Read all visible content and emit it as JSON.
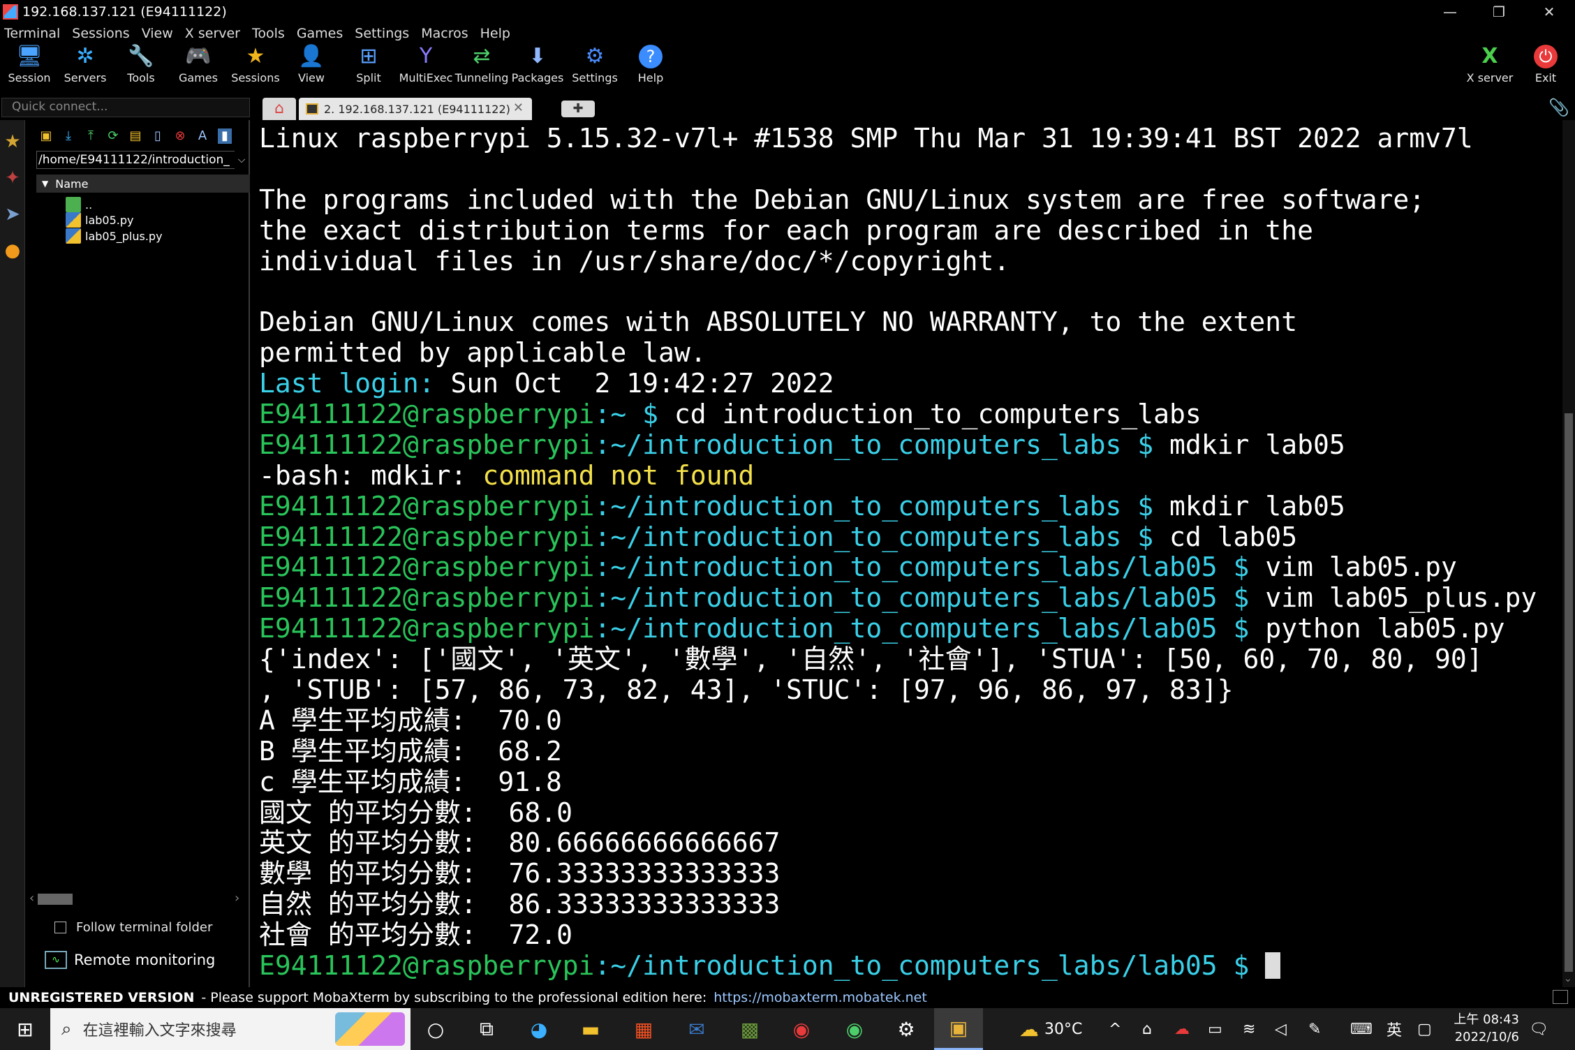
{
  "window": {
    "title": "192.168.137.121 (E94111122)",
    "controls": {
      "minimize": "—",
      "restore": "❐",
      "close": "✕"
    }
  },
  "menu": [
    "Terminal",
    "Sessions",
    "View",
    "X server",
    "Tools",
    "Games",
    "Settings",
    "Macros",
    "Help"
  ],
  "toolbar": {
    "items": [
      {
        "label": "Session",
        "icon": "session-icon",
        "glyph": "🖥",
        "color": "#4aa3ff"
      },
      {
        "label": "Servers",
        "icon": "servers-icon",
        "glyph": "✲",
        "color": "#3ab0ff"
      },
      {
        "label": "Tools",
        "icon": "tools-icon",
        "glyph": "🔧",
        "color": "#e84a4a"
      },
      {
        "label": "Games",
        "icon": "games-icon",
        "glyph": "🎮",
        "color": "#dddddd"
      },
      {
        "label": "Sessions",
        "icon": "star-icon",
        "glyph": "★",
        "color": "#f2b51c"
      },
      {
        "label": "View",
        "icon": "view-icon",
        "glyph": "👤",
        "color": "#9fc6ff"
      },
      {
        "label": "Split",
        "icon": "split-icon",
        "glyph": "⊞",
        "color": "#5aa0ff"
      },
      {
        "label": "MultiExec",
        "icon": "multiexec-icon",
        "glyph": "Y",
        "color": "#8a7cff"
      },
      {
        "label": "Tunneling",
        "icon": "tunneling-icon",
        "glyph": "⇄",
        "color": "#4ccf6a"
      },
      {
        "label": "Packages",
        "icon": "packages-icon",
        "glyph": "⬇",
        "color": "#8fb8ff"
      },
      {
        "label": "Settings",
        "icon": "settings-icon",
        "glyph": "⚙",
        "color": "#4a8cff"
      },
      {
        "label": "Help",
        "icon": "help-icon",
        "glyph": "?",
        "color": "#ffffff"
      }
    ],
    "right": [
      {
        "label": "X server",
        "icon": "xserver-icon",
        "glyph": "X",
        "color": "#4ccf4c"
      },
      {
        "label": "Exit",
        "icon": "power-icon",
        "glyph": "⏻",
        "color": "#e83a3a"
      }
    ]
  },
  "quick_connect": {
    "placeholder": "Quick connect..."
  },
  "tabs": {
    "home_glyph": "⌂",
    "active_label": "2. 192.168.137.121 (E94111122)",
    "close_glyph": "✕",
    "new_glyph": "✚",
    "clip_glyph": "📎"
  },
  "sidebar": {
    "path": "/home/E94111122/introduction_",
    "column": "Name",
    "files": [
      {
        "name": "..",
        "icon": "parent-folder-icon"
      },
      {
        "name": "lab05.py",
        "icon": "python-file-icon"
      },
      {
        "name": "lab05_plus.py",
        "icon": "python-file-icon"
      }
    ],
    "follow_label": "Follow terminal folder",
    "remote_label": "Remote monitoring"
  },
  "terminal": {
    "lines": [
      [
        [
          "Linux raspberrypi 5.15.32-v7l+ #1538 SMP Thu Mar 31 19:39:41 BST 2022 armv7l",
          "w"
        ]
      ],
      [
        [
          "",
          "w"
        ]
      ],
      [
        [
          "The programs included with the Debian GNU/Linux system are free software;",
          "w"
        ]
      ],
      [
        [
          "the exact distribution terms for each program are described in the",
          "w"
        ]
      ],
      [
        [
          "individual files in /usr/share/doc/*/copyright.",
          "w"
        ]
      ],
      [
        [
          "",
          "w"
        ]
      ],
      [
        [
          "Debian GNU/Linux comes with ABSOLUTELY NO WARRANTY, to the extent",
          "w"
        ]
      ],
      [
        [
          "permitted by applicable law.",
          "w"
        ]
      ],
      [
        [
          "Last login:",
          "c"
        ],
        [
          " Sun Oct  2 19:42:27 2022",
          "w"
        ]
      ],
      [
        [
          "E94111122@raspberrypi",
          "g"
        ],
        [
          ":~ $",
          "c"
        ],
        [
          " cd introduction_to_computers_labs",
          "w"
        ]
      ],
      [
        [
          "E94111122@raspberrypi",
          "g"
        ],
        [
          ":~/introduction_to_computers_labs $",
          "c"
        ],
        [
          " mdkir lab05",
          "w"
        ]
      ],
      [
        [
          "-bash: mdkir: ",
          "w"
        ],
        [
          "command not found",
          "y"
        ]
      ],
      [
        [
          "E94111122@raspberrypi",
          "g"
        ],
        [
          ":~/introduction_to_computers_labs $",
          "c"
        ],
        [
          " mkdir lab05",
          "w"
        ]
      ],
      [
        [
          "E94111122@raspberrypi",
          "g"
        ],
        [
          ":~/introduction_to_computers_labs $",
          "c"
        ],
        [
          " cd lab05",
          "w"
        ]
      ],
      [
        [
          "E94111122@raspberrypi",
          "g"
        ],
        [
          ":~/introduction_to_computers_labs/lab05 $",
          "c"
        ],
        [
          " vim lab05.py",
          "w"
        ]
      ],
      [
        [
          "E94111122@raspberrypi",
          "g"
        ],
        [
          ":~/introduction_to_computers_labs/lab05 $",
          "c"
        ],
        [
          " vim lab05_plus.py",
          "w"
        ]
      ],
      [
        [
          "E94111122@raspberrypi",
          "g"
        ],
        [
          ":~/introduction_to_computers_labs/lab05 $",
          "c"
        ],
        [
          " python lab05.py",
          "w"
        ]
      ],
      [
        [
          "{'index': ['國文', '英文', '數學', '自然', '社會'], 'STUA': [50, 60, 70, 80, 90]",
          "w"
        ]
      ],
      [
        [
          ", 'STUB': [57, 86, 73, 82, 43], 'STUC': [97, 96, 86, 97, 83]}",
          "w"
        ]
      ],
      [
        [
          "A 學生平均成績:  70.0",
          "w"
        ]
      ],
      [
        [
          "B 學生平均成績:  68.2",
          "w"
        ]
      ],
      [
        [
          "c 學生平均成績:  91.8",
          "w"
        ]
      ],
      [
        [
          "國文 的平均分數:  68.0",
          "w"
        ]
      ],
      [
        [
          "英文 的平均分數:  80.66666666666667",
          "w"
        ]
      ],
      [
        [
          "數學 的平均分數:  76.33333333333333",
          "w"
        ]
      ],
      [
        [
          "自然 的平均分數:  86.33333333333333",
          "w"
        ]
      ],
      [
        [
          "社會 的平均分數:  72.0",
          "w"
        ]
      ],
      [
        [
          "E94111122@raspberrypi",
          "g"
        ],
        [
          ":~/introduction_to_computers_labs/lab05 $",
          "c"
        ],
        [
          " ",
          "w"
        ]
      ]
    ]
  },
  "status": {
    "unregistered": "UNREGISTERED VERSION",
    "message": "-  Please support MobaXterm by subscribing to the professional edition here:",
    "link": "https://mobaxterm.mobatek.net"
  },
  "taskbar": {
    "search_placeholder": "在這裡輸入文字來搜尋",
    "weather": "30°C",
    "ime": "英",
    "time": "上午 08:43",
    "date": "2022/10/6"
  }
}
